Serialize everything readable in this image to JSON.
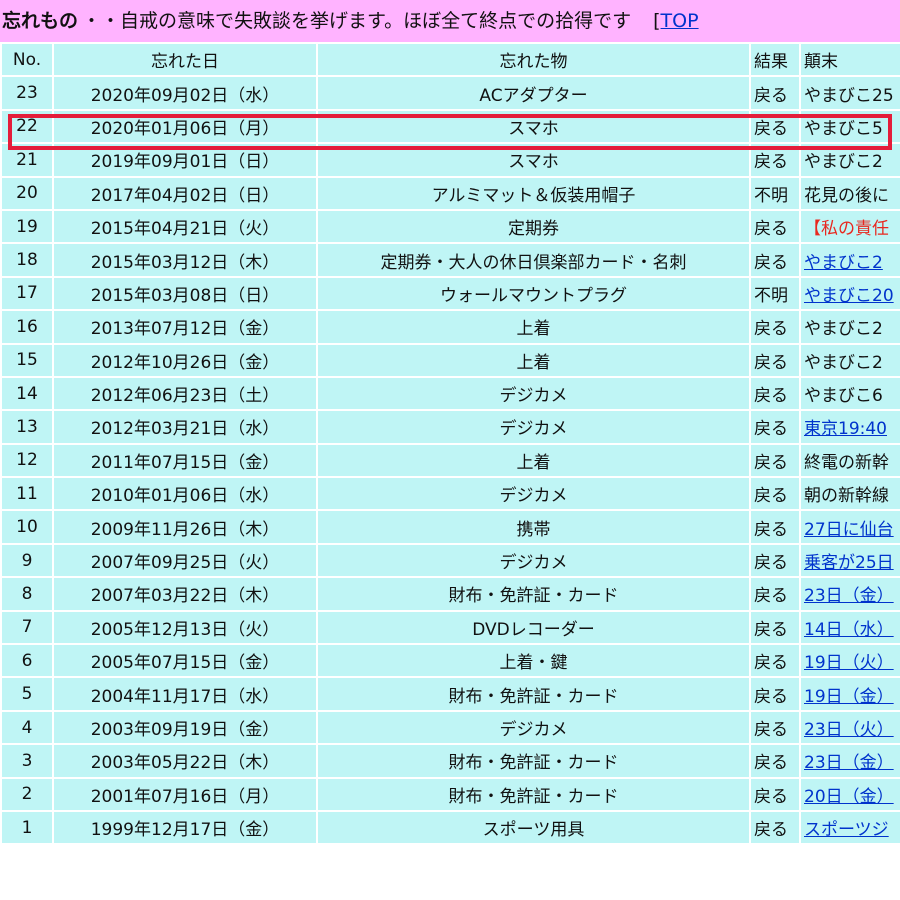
{
  "header": {
    "title": "忘れもの",
    "desc": "・・自戒の意味で失敗談を挙げます。ほぼ全て終点での拾得です",
    "top_prefix": "[",
    "top_link": "TOP"
  },
  "columns": [
    "No.",
    "忘れた日",
    "忘れた物",
    "結果",
    "顛末"
  ],
  "highlighted_row_no": "22",
  "rows": [
    {
      "no": "23",
      "date": "2020年09月02日（水）",
      "item": "ACアダプター",
      "result": "戻る",
      "ending": "やまびこ25",
      "kind": "text"
    },
    {
      "no": "22",
      "date": "2020年01月06日（月）",
      "item": "スマホ",
      "result": "戻る",
      "ending": "やまびこ5",
      "kind": "text"
    },
    {
      "no": "21",
      "date": "2019年09月01日（日）",
      "item": "スマホ",
      "result": "戻る",
      "ending": "やまびこ2",
      "kind": "text"
    },
    {
      "no": "20",
      "date": "2017年04月02日（日）",
      "item": "アルミマット＆仮装用帽子",
      "result": "不明",
      "ending": "花見の後に",
      "kind": "text"
    },
    {
      "no": "19",
      "date": "2015年04月21日（火）",
      "item": "定期券",
      "result": "戻る",
      "ending": "【私の責任",
      "kind": "red"
    },
    {
      "no": "18",
      "date": "2015年03月12日（木）",
      "item": "定期券・大人の休日倶楽部カード・名刺",
      "result": "戻る",
      "ending": "やまびこ2",
      "kind": "link"
    },
    {
      "no": "17",
      "date": "2015年03月08日（日）",
      "item": "ウォールマウントプラグ",
      "result": "不明",
      "ending": "やまびこ20",
      "kind": "link"
    },
    {
      "no": "16",
      "date": "2013年07月12日（金）",
      "item": "上着",
      "result": "戻る",
      "ending": "やまびこ2",
      "kind": "text"
    },
    {
      "no": "15",
      "date": "2012年10月26日（金）",
      "item": "上着",
      "result": "戻る",
      "ending": "やまびこ2",
      "kind": "text"
    },
    {
      "no": "14",
      "date": "2012年06月23日（土）",
      "item": "デジカメ",
      "result": "戻る",
      "ending": "やまびこ6",
      "kind": "text"
    },
    {
      "no": "13",
      "date": "2012年03月21日（水）",
      "item": "デジカメ",
      "result": "戻る",
      "ending": "東京19:40",
      "kind": "link"
    },
    {
      "no": "12",
      "date": "2011年07月15日（金）",
      "item": "上着",
      "result": "戻る",
      "ending": "終電の新幹",
      "kind": "text"
    },
    {
      "no": "11",
      "date": "2010年01月06日（水）",
      "item": "デジカメ",
      "result": "戻る",
      "ending": "朝の新幹線",
      "kind": "text"
    },
    {
      "no": "10",
      "date": "2009年11月26日（木）",
      "item": "携帯",
      "result": "戻る",
      "ending": "27日に仙台",
      "kind": "link"
    },
    {
      "no": "9",
      "date": "2007年09月25日（火）",
      "item": "デジカメ",
      "result": "戻る",
      "ending": "乗客が25日",
      "kind": "link"
    },
    {
      "no": "8",
      "date": "2007年03月22日（木）",
      "item": "財布・免許証・カード",
      "result": "戻る",
      "ending": "23日（金）",
      "kind": "link"
    },
    {
      "no": "7",
      "date": "2005年12月13日（火）",
      "item": "DVDレコーダー",
      "result": "戻る",
      "ending": "14日（水）",
      "kind": "link"
    },
    {
      "no": "6",
      "date": "2005年07月15日（金）",
      "item": "上着・鍵",
      "result": "戻る",
      "ending": "19日（火）",
      "kind": "link"
    },
    {
      "no": "5",
      "date": "2004年11月17日（水）",
      "item": "財布・免許証・カード",
      "result": "戻る",
      "ending": "19日（金）",
      "kind": "link"
    },
    {
      "no": "4",
      "date": "2003年09月19日（金）",
      "item": "デジカメ",
      "result": "戻る",
      "ending": "23日（火）",
      "kind": "link"
    },
    {
      "no": "3",
      "date": "2003年05月22日（木）",
      "item": "財布・免許証・カード",
      "result": "戻る",
      "ending": "23日（金）",
      "kind": "link"
    },
    {
      "no": "2",
      "date": "2001年07月16日（月）",
      "item": "財布・免許証・カード",
      "result": "戻る",
      "ending": "20日（金）",
      "kind": "link"
    },
    {
      "no": "1",
      "date": "1999年12月17日（金）",
      "item": "スポーツ用具",
      "result": "戻る",
      "ending": "スポーツジ",
      "kind": "link"
    }
  ]
}
